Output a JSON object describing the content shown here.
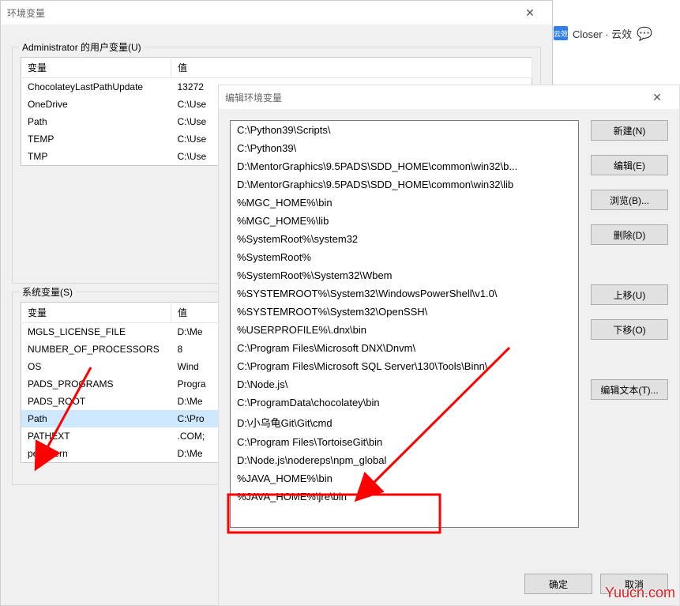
{
  "backgroundHeader": {
    "badge": "云效",
    "text": "Closer · 云效"
  },
  "envDialog": {
    "title": "环境变量",
    "userGroup": {
      "legend": "Administrator 的用户变量(U)",
      "headers": {
        "name": "变量",
        "value": "值"
      },
      "rows": [
        {
          "name": "ChocolateyLastPathUpdate",
          "value": "13272"
        },
        {
          "name": "OneDrive",
          "value": "C:\\Use"
        },
        {
          "name": "Path",
          "value": "C:\\Use"
        },
        {
          "name": "TEMP",
          "value": "C:\\Use"
        },
        {
          "name": "TMP",
          "value": "C:\\Use"
        }
      ]
    },
    "sysGroup": {
      "legend": "系统变量(S)",
      "headers": {
        "name": "变量",
        "value": "值"
      },
      "rows": [
        {
          "name": "MGLS_LICENSE_FILE",
          "value": "D:\\Me"
        },
        {
          "name": "NUMBER_OF_PROCESSORS",
          "value": "8"
        },
        {
          "name": "OS",
          "value": "Wind"
        },
        {
          "name": "PADS_PROGRAMS",
          "value": "Progra"
        },
        {
          "name": "PADS_ROOT",
          "value": "D:\\Me"
        },
        {
          "name": "Path",
          "value": "C:\\Pro",
          "selected": true
        },
        {
          "name": "PATHEXT",
          "value": ".COM;"
        },
        {
          "name": "perlIntern",
          "value": "D:\\Me"
        }
      ]
    }
  },
  "editDialog": {
    "title": "编辑环境变量",
    "items": [
      "C:\\Python39\\Scripts\\",
      "C:\\Python39\\",
      "D:\\MentorGraphics\\9.5PADS\\SDD_HOME\\common\\win32\\b...",
      "D:\\MentorGraphics\\9.5PADS\\SDD_HOME\\common\\win32\\lib",
      "%MGC_HOME%\\bin",
      "%MGC_HOME%\\lib",
      "%SystemRoot%\\system32",
      "%SystemRoot%",
      "%SystemRoot%\\System32\\Wbem",
      "%SYSTEMROOT%\\System32\\WindowsPowerShell\\v1.0\\",
      "%SYSTEMROOT%\\System32\\OpenSSH\\",
      "%USERPROFILE%\\.dnx\\bin",
      "C:\\Program Files\\Microsoft DNX\\Dnvm\\",
      "C:\\Program Files\\Microsoft SQL Server\\130\\Tools\\Binn\\",
      "D:\\Node.js\\",
      "C:\\ProgramData\\chocolatey\\bin",
      "D:\\小乌龟Git\\Git\\cmd",
      "C:\\Program Files\\TortoiseGit\\bin",
      "D:\\Node.js\\nodereps\\npm_global",
      "%JAVA_HOME%\\bin",
      "%JAVA_HOME%\\jre\\bin"
    ],
    "buttons": {
      "new": "新建(N)",
      "edit": "编辑(E)",
      "browse": "浏览(B)...",
      "delete": "删除(D)",
      "moveUp": "上移(U)",
      "moveDown": "下移(O)",
      "editText": "编辑文本(T)...",
      "ok": "确定",
      "cancel": "取消"
    }
  },
  "watermark": "Yuucn.com",
  "annot": {
    "color": "#ff0000"
  }
}
